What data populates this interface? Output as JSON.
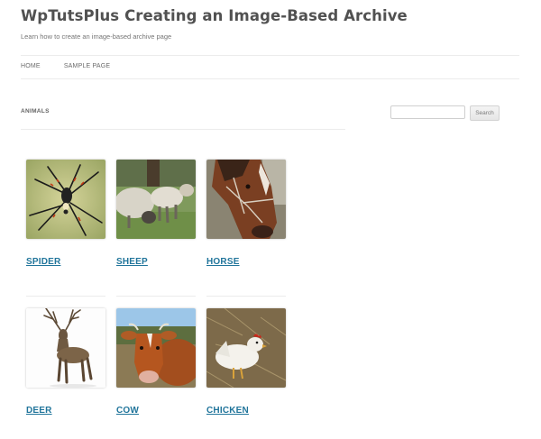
{
  "site": {
    "title": "WpTutsPlus Creating an Image-Based Archive",
    "description": "Learn how to create an image-based archive page"
  },
  "nav": {
    "items": [
      {
        "label": "HOME"
      },
      {
        "label": "SAMPLE PAGE"
      }
    ]
  },
  "archive": {
    "title": "ANIMALS",
    "items": [
      {
        "label": "SPIDER",
        "icon": "spider-image"
      },
      {
        "label": "SHEEP",
        "icon": "sheep-image"
      },
      {
        "label": "HORSE",
        "icon": "horse-image"
      },
      {
        "label": "DEER",
        "icon": "deer-image"
      },
      {
        "label": "COW",
        "icon": "cow-image"
      },
      {
        "label": "CHICKEN",
        "icon": "chicken-image"
      }
    ]
  },
  "sidebar": {
    "search": {
      "value": "",
      "button_label": "Search"
    }
  },
  "colors": {
    "link": "#21759b",
    "title": "#515151",
    "rule": "#ececec"
  }
}
